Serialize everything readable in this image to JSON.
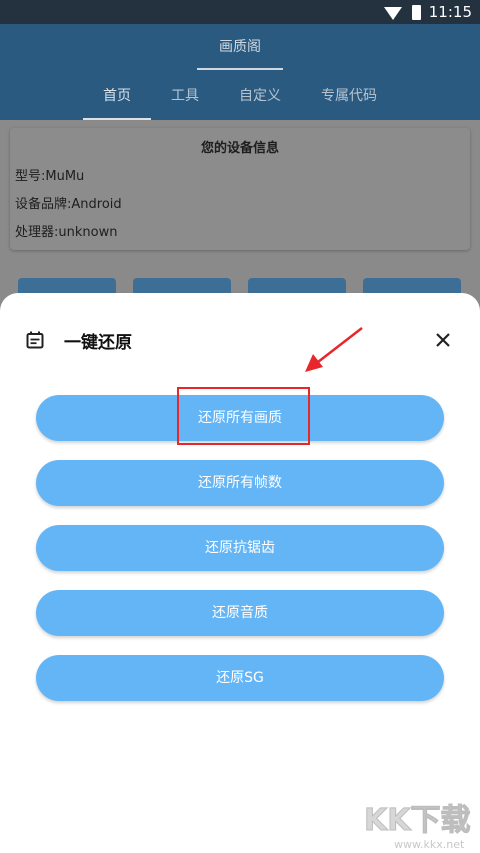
{
  "status_bar": {
    "time": "11:15"
  },
  "app_bar": {
    "title": "画质阁"
  },
  "tabs": [
    {
      "label": "首页",
      "active": true
    },
    {
      "label": "工具",
      "active": false
    },
    {
      "label": "自定义",
      "active": false
    },
    {
      "label": "专属代码",
      "active": false
    }
  ],
  "device_info": {
    "title": "您的设备信息",
    "model": "型号:MuMu",
    "brand": "设备品牌:Android",
    "processor": "处理器:unknown"
  },
  "sheet": {
    "title": "一键还原",
    "icon": "calendar-icon",
    "close_icon": "close-icon",
    "buttons": [
      "还原所有画质",
      "还原所有帧数",
      "还原抗锯齿",
      "还原音质",
      "还原SG"
    ]
  },
  "watermark": {
    "logo": "KK下载",
    "url": "www.kkx.net"
  },
  "colors": {
    "button": "#64b5f6",
    "highlight": "#e8262c",
    "app_bar": "#2b5a80"
  }
}
